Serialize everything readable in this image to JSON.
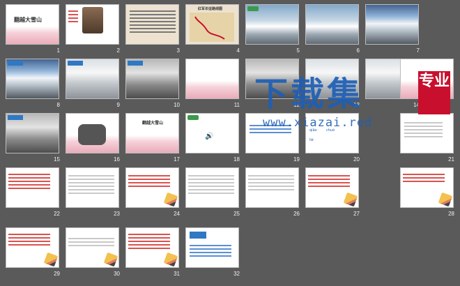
{
  "slides": [
    {
      "num": "1",
      "title": "翻越大雪山"
    },
    {
      "num": "2"
    },
    {
      "num": "3"
    },
    {
      "num": "4",
      "title": "红军长征路线图"
    },
    {
      "num": "5"
    },
    {
      "num": "6"
    },
    {
      "num": "7"
    },
    {
      "num": "8"
    },
    {
      "num": "9"
    },
    {
      "num": "10"
    },
    {
      "num": "11"
    },
    {
      "num": "12"
    },
    {
      "num": "13"
    },
    {
      "num": "14"
    },
    {
      "num": "15"
    },
    {
      "num": "16"
    },
    {
      "num": "17",
      "title": "翻越大雪山"
    },
    {
      "num": "18"
    },
    {
      "num": "19"
    },
    {
      "num": "20"
    },
    {
      "num": "21"
    },
    {
      "num": "22"
    },
    {
      "num": "23"
    },
    {
      "num": "24"
    },
    {
      "num": "25"
    },
    {
      "num": "26"
    },
    {
      "num": "27"
    },
    {
      "num": "28"
    },
    {
      "num": "29"
    },
    {
      "num": "30"
    },
    {
      "num": "31"
    },
    {
      "num": "32"
    }
  ],
  "watermark": {
    "brand": "下载集",
    "seal": "专业",
    "url": "www.xiazai.red"
  },
  "slide20": {
    "pinyin": [
      "qiǎo",
      "chuò",
      "liè"
    ]
  },
  "colors": {
    "background": "#5a5a5a",
    "accent_red": "#c8102e",
    "accent_blue": "#1f5fb5"
  }
}
